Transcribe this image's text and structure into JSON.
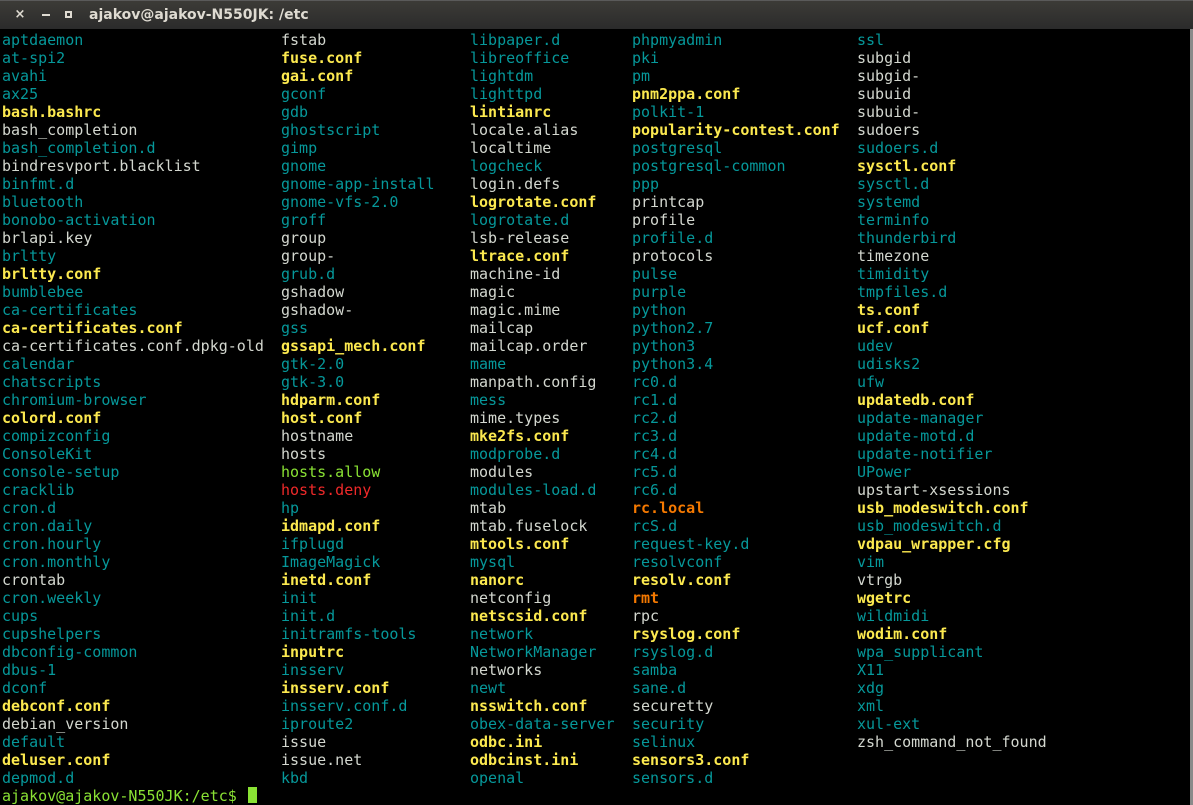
{
  "window": {
    "title": "ajakov@ajakov-N550JK: /etc",
    "buttons": {
      "close": "×",
      "minimize": "minimize",
      "maximize": "maximize"
    }
  },
  "colors": {
    "directory": "#06989a",
    "regular_file": "#d3d7cf",
    "config_file": "#fce94f",
    "executable": "#8ae234",
    "special_red": "#ef2929",
    "special_orange": "#f57900",
    "prompt": "#8ae234",
    "background": "#000000"
  },
  "columns": [
    [
      {
        "name": "aptdaemon",
        "type": "dir"
      },
      {
        "name": "at-spi2",
        "type": "dir"
      },
      {
        "name": "avahi",
        "type": "dir"
      },
      {
        "name": "ax25",
        "type": "dir"
      },
      {
        "name": "bash.bashrc",
        "type": "conf"
      },
      {
        "name": "bash_completion",
        "type": "file"
      },
      {
        "name": "bash_completion.d",
        "type": "dir"
      },
      {
        "name": "bindresvport.blacklist",
        "type": "file"
      },
      {
        "name": "binfmt.d",
        "type": "dir"
      },
      {
        "name": "bluetooth",
        "type": "dir"
      },
      {
        "name": "bonobo-activation",
        "type": "dir"
      },
      {
        "name": "brlapi.key",
        "type": "file"
      },
      {
        "name": "brltty",
        "type": "dir"
      },
      {
        "name": "brltty.conf",
        "type": "conf"
      },
      {
        "name": "bumblebee",
        "type": "dir"
      },
      {
        "name": "ca-certificates",
        "type": "dir"
      },
      {
        "name": "ca-certificates.conf",
        "type": "conf"
      },
      {
        "name": "ca-certificates.conf.dpkg-old",
        "type": "file"
      },
      {
        "name": "calendar",
        "type": "dir"
      },
      {
        "name": "chatscripts",
        "type": "dir"
      },
      {
        "name": "chromium-browser",
        "type": "dir"
      },
      {
        "name": "colord.conf",
        "type": "conf"
      },
      {
        "name": "compizconfig",
        "type": "dir"
      },
      {
        "name": "ConsoleKit",
        "type": "dir"
      },
      {
        "name": "console-setup",
        "type": "dir"
      },
      {
        "name": "cracklib",
        "type": "dir"
      },
      {
        "name": "cron.d",
        "type": "dir"
      },
      {
        "name": "cron.daily",
        "type": "dir"
      },
      {
        "name": "cron.hourly",
        "type": "dir"
      },
      {
        "name": "cron.monthly",
        "type": "dir"
      },
      {
        "name": "crontab",
        "type": "file"
      },
      {
        "name": "cron.weekly",
        "type": "dir"
      },
      {
        "name": "cups",
        "type": "dir"
      },
      {
        "name": "cupshelpers",
        "type": "dir"
      },
      {
        "name": "dbconfig-common",
        "type": "dir"
      },
      {
        "name": "dbus-1",
        "type": "dir"
      },
      {
        "name": "dconf",
        "type": "dir"
      },
      {
        "name": "debconf.conf",
        "type": "conf"
      },
      {
        "name": "debian_version",
        "type": "file"
      },
      {
        "name": "default",
        "type": "dir"
      },
      {
        "name": "deluser.conf",
        "type": "conf"
      },
      {
        "name": "depmod.d",
        "type": "dir"
      }
    ],
    [
      {
        "name": "fstab",
        "type": "file"
      },
      {
        "name": "fuse.conf",
        "type": "conf"
      },
      {
        "name": "gai.conf",
        "type": "conf"
      },
      {
        "name": "gconf",
        "type": "dir"
      },
      {
        "name": "gdb",
        "type": "dir"
      },
      {
        "name": "ghostscript",
        "type": "dir"
      },
      {
        "name": "gimp",
        "type": "dir"
      },
      {
        "name": "gnome",
        "type": "dir"
      },
      {
        "name": "gnome-app-install",
        "type": "dir"
      },
      {
        "name": "gnome-vfs-2.0",
        "type": "dir"
      },
      {
        "name": "groff",
        "type": "dir"
      },
      {
        "name": "group",
        "type": "file"
      },
      {
        "name": "group-",
        "type": "file"
      },
      {
        "name": "grub.d",
        "type": "dir"
      },
      {
        "name": "gshadow",
        "type": "file"
      },
      {
        "name": "gshadow-",
        "type": "file"
      },
      {
        "name": "gss",
        "type": "dir"
      },
      {
        "name": "gssapi_mech.conf",
        "type": "conf"
      },
      {
        "name": "gtk-2.0",
        "type": "dir"
      },
      {
        "name": "gtk-3.0",
        "type": "dir"
      },
      {
        "name": "hdparm.conf",
        "type": "conf"
      },
      {
        "name": "host.conf",
        "type": "conf"
      },
      {
        "name": "hostname",
        "type": "file"
      },
      {
        "name": "hosts",
        "type": "file"
      },
      {
        "name": "hosts.allow",
        "type": "green"
      },
      {
        "name": "hosts.deny",
        "type": "red"
      },
      {
        "name": "hp",
        "type": "dir"
      },
      {
        "name": "idmapd.conf",
        "type": "conf"
      },
      {
        "name": "ifplugd",
        "type": "dir"
      },
      {
        "name": "ImageMagick",
        "type": "dir"
      },
      {
        "name": "inetd.conf",
        "type": "conf"
      },
      {
        "name": "init",
        "type": "dir"
      },
      {
        "name": "init.d",
        "type": "dir"
      },
      {
        "name": "initramfs-tools",
        "type": "dir"
      },
      {
        "name": "inputrc",
        "type": "conf"
      },
      {
        "name": "insserv",
        "type": "dir"
      },
      {
        "name": "insserv.conf",
        "type": "conf"
      },
      {
        "name": "insserv.conf.d",
        "type": "dir"
      },
      {
        "name": "iproute2",
        "type": "dir"
      },
      {
        "name": "issue",
        "type": "file"
      },
      {
        "name": "issue.net",
        "type": "file"
      },
      {
        "name": "kbd",
        "type": "dir"
      }
    ],
    [
      {
        "name": "libpaper.d",
        "type": "dir"
      },
      {
        "name": "libreoffice",
        "type": "dir"
      },
      {
        "name": "lightdm",
        "type": "dir"
      },
      {
        "name": "lighttpd",
        "type": "dir"
      },
      {
        "name": "lintianrc",
        "type": "conf"
      },
      {
        "name": "locale.alias",
        "type": "file"
      },
      {
        "name": "localtime",
        "type": "file"
      },
      {
        "name": "logcheck",
        "type": "dir"
      },
      {
        "name": "login.defs",
        "type": "file"
      },
      {
        "name": "logrotate.conf",
        "type": "conf"
      },
      {
        "name": "logrotate.d",
        "type": "dir"
      },
      {
        "name": "lsb-release",
        "type": "file"
      },
      {
        "name": "ltrace.conf",
        "type": "conf"
      },
      {
        "name": "machine-id",
        "type": "file"
      },
      {
        "name": "magic",
        "type": "file"
      },
      {
        "name": "magic.mime",
        "type": "file"
      },
      {
        "name": "mailcap",
        "type": "file"
      },
      {
        "name": "mailcap.order",
        "type": "file"
      },
      {
        "name": "mame",
        "type": "dir"
      },
      {
        "name": "manpath.config",
        "type": "file"
      },
      {
        "name": "mess",
        "type": "dir"
      },
      {
        "name": "mime.types",
        "type": "file"
      },
      {
        "name": "mke2fs.conf",
        "type": "conf"
      },
      {
        "name": "modprobe.d",
        "type": "dir"
      },
      {
        "name": "modules",
        "type": "file"
      },
      {
        "name": "modules-load.d",
        "type": "dir"
      },
      {
        "name": "mtab",
        "type": "file"
      },
      {
        "name": "mtab.fuselock",
        "type": "file"
      },
      {
        "name": "mtools.conf",
        "type": "conf"
      },
      {
        "name": "mysql",
        "type": "dir"
      },
      {
        "name": "nanorc",
        "type": "conf"
      },
      {
        "name": "netconfig",
        "type": "file"
      },
      {
        "name": "netscsid.conf",
        "type": "conf"
      },
      {
        "name": "network",
        "type": "dir"
      },
      {
        "name": "NetworkManager",
        "type": "dir"
      },
      {
        "name": "networks",
        "type": "file"
      },
      {
        "name": "newt",
        "type": "dir"
      },
      {
        "name": "nsswitch.conf",
        "type": "conf"
      },
      {
        "name": "obex-data-server",
        "type": "dir"
      },
      {
        "name": "odbc.ini",
        "type": "conf"
      },
      {
        "name": "odbcinst.ini",
        "type": "conf"
      },
      {
        "name": "openal",
        "type": "dir"
      }
    ],
    [
      {
        "name": "phpmyadmin",
        "type": "dir"
      },
      {
        "name": "pki",
        "type": "dir"
      },
      {
        "name": "pm",
        "type": "dir"
      },
      {
        "name": "pnm2ppa.conf",
        "type": "conf"
      },
      {
        "name": "polkit-1",
        "type": "dir"
      },
      {
        "name": "popularity-contest.conf",
        "type": "conf"
      },
      {
        "name": "postgresql",
        "type": "dir"
      },
      {
        "name": "postgresql-common",
        "type": "dir"
      },
      {
        "name": "ppp",
        "type": "dir"
      },
      {
        "name": "printcap",
        "type": "file"
      },
      {
        "name": "profile",
        "type": "file"
      },
      {
        "name": "profile.d",
        "type": "dir"
      },
      {
        "name": "protocols",
        "type": "file"
      },
      {
        "name": "pulse",
        "type": "dir"
      },
      {
        "name": "purple",
        "type": "dir"
      },
      {
        "name": "python",
        "type": "dir"
      },
      {
        "name": "python2.7",
        "type": "dir"
      },
      {
        "name": "python3",
        "type": "dir"
      },
      {
        "name": "python3.4",
        "type": "dir"
      },
      {
        "name": "rc0.d",
        "type": "dir"
      },
      {
        "name": "rc1.d",
        "type": "dir"
      },
      {
        "name": "rc2.d",
        "type": "dir"
      },
      {
        "name": "rc3.d",
        "type": "dir"
      },
      {
        "name": "rc4.d",
        "type": "dir"
      },
      {
        "name": "rc5.d",
        "type": "dir"
      },
      {
        "name": "rc6.d",
        "type": "dir"
      },
      {
        "name": "rc.local",
        "type": "orange"
      },
      {
        "name": "rcS.d",
        "type": "dir"
      },
      {
        "name": "request-key.d",
        "type": "dir"
      },
      {
        "name": "resolvconf",
        "type": "dir"
      },
      {
        "name": "resolv.conf",
        "type": "conf"
      },
      {
        "name": "rmt",
        "type": "orange"
      },
      {
        "name": "rpc",
        "type": "file"
      },
      {
        "name": "rsyslog.conf",
        "type": "conf"
      },
      {
        "name": "rsyslog.d",
        "type": "dir"
      },
      {
        "name": "samba",
        "type": "dir"
      },
      {
        "name": "sane.d",
        "type": "dir"
      },
      {
        "name": "securetty",
        "type": "file"
      },
      {
        "name": "security",
        "type": "dir"
      },
      {
        "name": "selinux",
        "type": "dir"
      },
      {
        "name": "sensors3.conf",
        "type": "conf"
      },
      {
        "name": "sensors.d",
        "type": "dir"
      }
    ],
    [
      {
        "name": "ssl",
        "type": "dir"
      },
      {
        "name": "subgid",
        "type": "file"
      },
      {
        "name": "subgid-",
        "type": "file"
      },
      {
        "name": "subuid",
        "type": "file"
      },
      {
        "name": "subuid-",
        "type": "file"
      },
      {
        "name": "sudoers",
        "type": "file"
      },
      {
        "name": "sudoers.d",
        "type": "dir"
      },
      {
        "name": "sysctl.conf",
        "type": "conf"
      },
      {
        "name": "sysctl.d",
        "type": "dir"
      },
      {
        "name": "systemd",
        "type": "dir"
      },
      {
        "name": "terminfo",
        "type": "dir"
      },
      {
        "name": "thunderbird",
        "type": "dir"
      },
      {
        "name": "timezone",
        "type": "file"
      },
      {
        "name": "timidity",
        "type": "dir"
      },
      {
        "name": "tmpfiles.d",
        "type": "dir"
      },
      {
        "name": "ts.conf",
        "type": "conf"
      },
      {
        "name": "ucf.conf",
        "type": "conf"
      },
      {
        "name": "udev",
        "type": "dir"
      },
      {
        "name": "udisks2",
        "type": "dir"
      },
      {
        "name": "ufw",
        "type": "dir"
      },
      {
        "name": "updatedb.conf",
        "type": "conf"
      },
      {
        "name": "update-manager",
        "type": "dir"
      },
      {
        "name": "update-motd.d",
        "type": "dir"
      },
      {
        "name": "update-notifier",
        "type": "dir"
      },
      {
        "name": "UPower",
        "type": "dir"
      },
      {
        "name": "upstart-xsessions",
        "type": "file"
      },
      {
        "name": "usb_modeswitch.conf",
        "type": "conf"
      },
      {
        "name": "usb_modeswitch.d",
        "type": "dir"
      },
      {
        "name": "vdpau_wrapper.cfg",
        "type": "conf"
      },
      {
        "name": "vim",
        "type": "dir"
      },
      {
        "name": "vtrgb",
        "type": "file"
      },
      {
        "name": "wgetrc",
        "type": "conf"
      },
      {
        "name": "wildmidi",
        "type": "dir"
      },
      {
        "name": "wodim.conf",
        "type": "conf"
      },
      {
        "name": "wpa_supplicant",
        "type": "dir"
      },
      {
        "name": "X11",
        "type": "dir"
      },
      {
        "name": "xdg",
        "type": "dir"
      },
      {
        "name": "xml",
        "type": "dir"
      },
      {
        "name": "xul-ext",
        "type": "dir"
      },
      {
        "name": "zsh_command_not_found",
        "type": "file"
      }
    ]
  ],
  "prompt": {
    "text": "ajakov@ajakov-N550JK:/etc$ "
  }
}
